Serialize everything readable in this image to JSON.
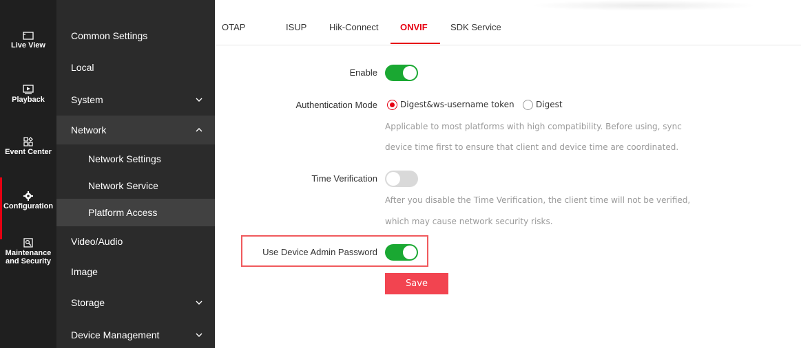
{
  "rail": {
    "items": [
      {
        "label": "Live View",
        "icon": "live-view-icon"
      },
      {
        "label": "Playback",
        "icon": "playback-icon"
      },
      {
        "label": "Event Center",
        "icon": "event-center-icon"
      },
      {
        "label": "Configuration",
        "icon": "gear-icon"
      },
      {
        "label": "Maintenance and Security",
        "label_line1": "Maintenance",
        "label_line2": "and Security",
        "icon": "maintenance-icon"
      }
    ],
    "active": "Configuration"
  },
  "menu": {
    "items": [
      {
        "label": "Common Settings"
      },
      {
        "label": "Local"
      },
      {
        "label": "System",
        "chevron": "down"
      },
      {
        "label": "Network",
        "chevron": "up",
        "expanded": true
      },
      {
        "label": "Video/Audio"
      },
      {
        "label": "Image"
      },
      {
        "label": "Storage",
        "chevron": "down"
      },
      {
        "label": "Device Management",
        "chevron": "down"
      }
    ],
    "network_sub": [
      {
        "label": "Network Settings"
      },
      {
        "label": "Network Service"
      },
      {
        "label": "Platform Access",
        "active": true
      }
    ]
  },
  "tabs": [
    {
      "label": "OTAP"
    },
    {
      "label": "ISUP"
    },
    {
      "label": "Hik-Connect"
    },
    {
      "label": "ONVIF",
      "active": true
    },
    {
      "label": "SDK Service"
    }
  ],
  "form": {
    "enable": {
      "label": "Enable",
      "value": true
    },
    "auth_mode": {
      "label": "Authentication Mode",
      "options": [
        "Digest&ws-username token",
        "Digest"
      ],
      "selected": "Digest&ws-username token",
      "hint_line1": "Applicable to most platforms with high compatibility. Before using, sync",
      "hint_line2": "device time first to ensure that client and device time are coordinated."
    },
    "time_verification": {
      "label": "Time Verification",
      "value": false,
      "hint_line1": "After you disable the Time Verification, the client time will not be verified,",
      "hint_line2": "which may cause network security risks."
    },
    "use_admin_password": {
      "label": "Use Device Admin Password",
      "value": true
    },
    "save_label": "Save"
  },
  "colors": {
    "accent": "#e60012",
    "toggle_on": "#1aa832",
    "toggle_off": "#d9d9d9",
    "save_button": "#f24450",
    "highlight_border": "#f0595c"
  }
}
